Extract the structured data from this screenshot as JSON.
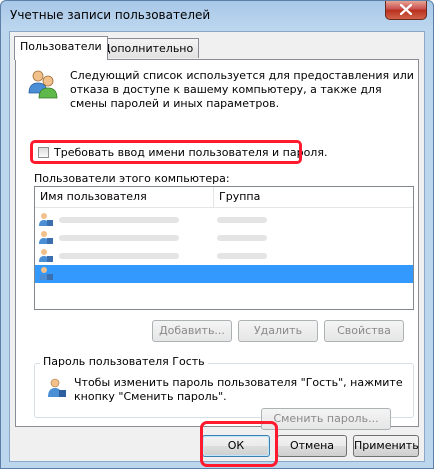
{
  "window": {
    "title": "Учетные записи пользователей"
  },
  "tabs": [
    {
      "label": "Пользователи",
      "active": true
    },
    {
      "label": "Дополнительно",
      "active": false
    }
  ],
  "users_tab": {
    "description": "Следующий список используется для предоставления или отказа в доступе к вашему компьютеру, а также для смены паролей и иных параметров.",
    "require_login_label": "Требовать ввод имени пользователя и пароля.",
    "require_login_checked": false,
    "list_caption": "Пользователи этого компьютера:",
    "columns": [
      "Имя пользователя",
      "Группа"
    ],
    "user_count": 4,
    "selected_row": 3,
    "buttons": {
      "add": "Добавить...",
      "remove": "Удалить",
      "properties": "Свойства"
    },
    "guest_group": {
      "title": "Пароль пользователя Гость",
      "text": "Чтобы изменить пароль пользователя \"Гость\", нажмите кнопку \"Сменить пароль\".",
      "change_password_button": "Сменить пароль..."
    }
  },
  "dialog_buttons": {
    "ok": "ОК",
    "cancel": "Отмена",
    "apply": "Применить"
  },
  "colors": {
    "highlight_annotation": "#ff1a2e",
    "selection": "#3399ff",
    "close_button": "#c75050"
  }
}
